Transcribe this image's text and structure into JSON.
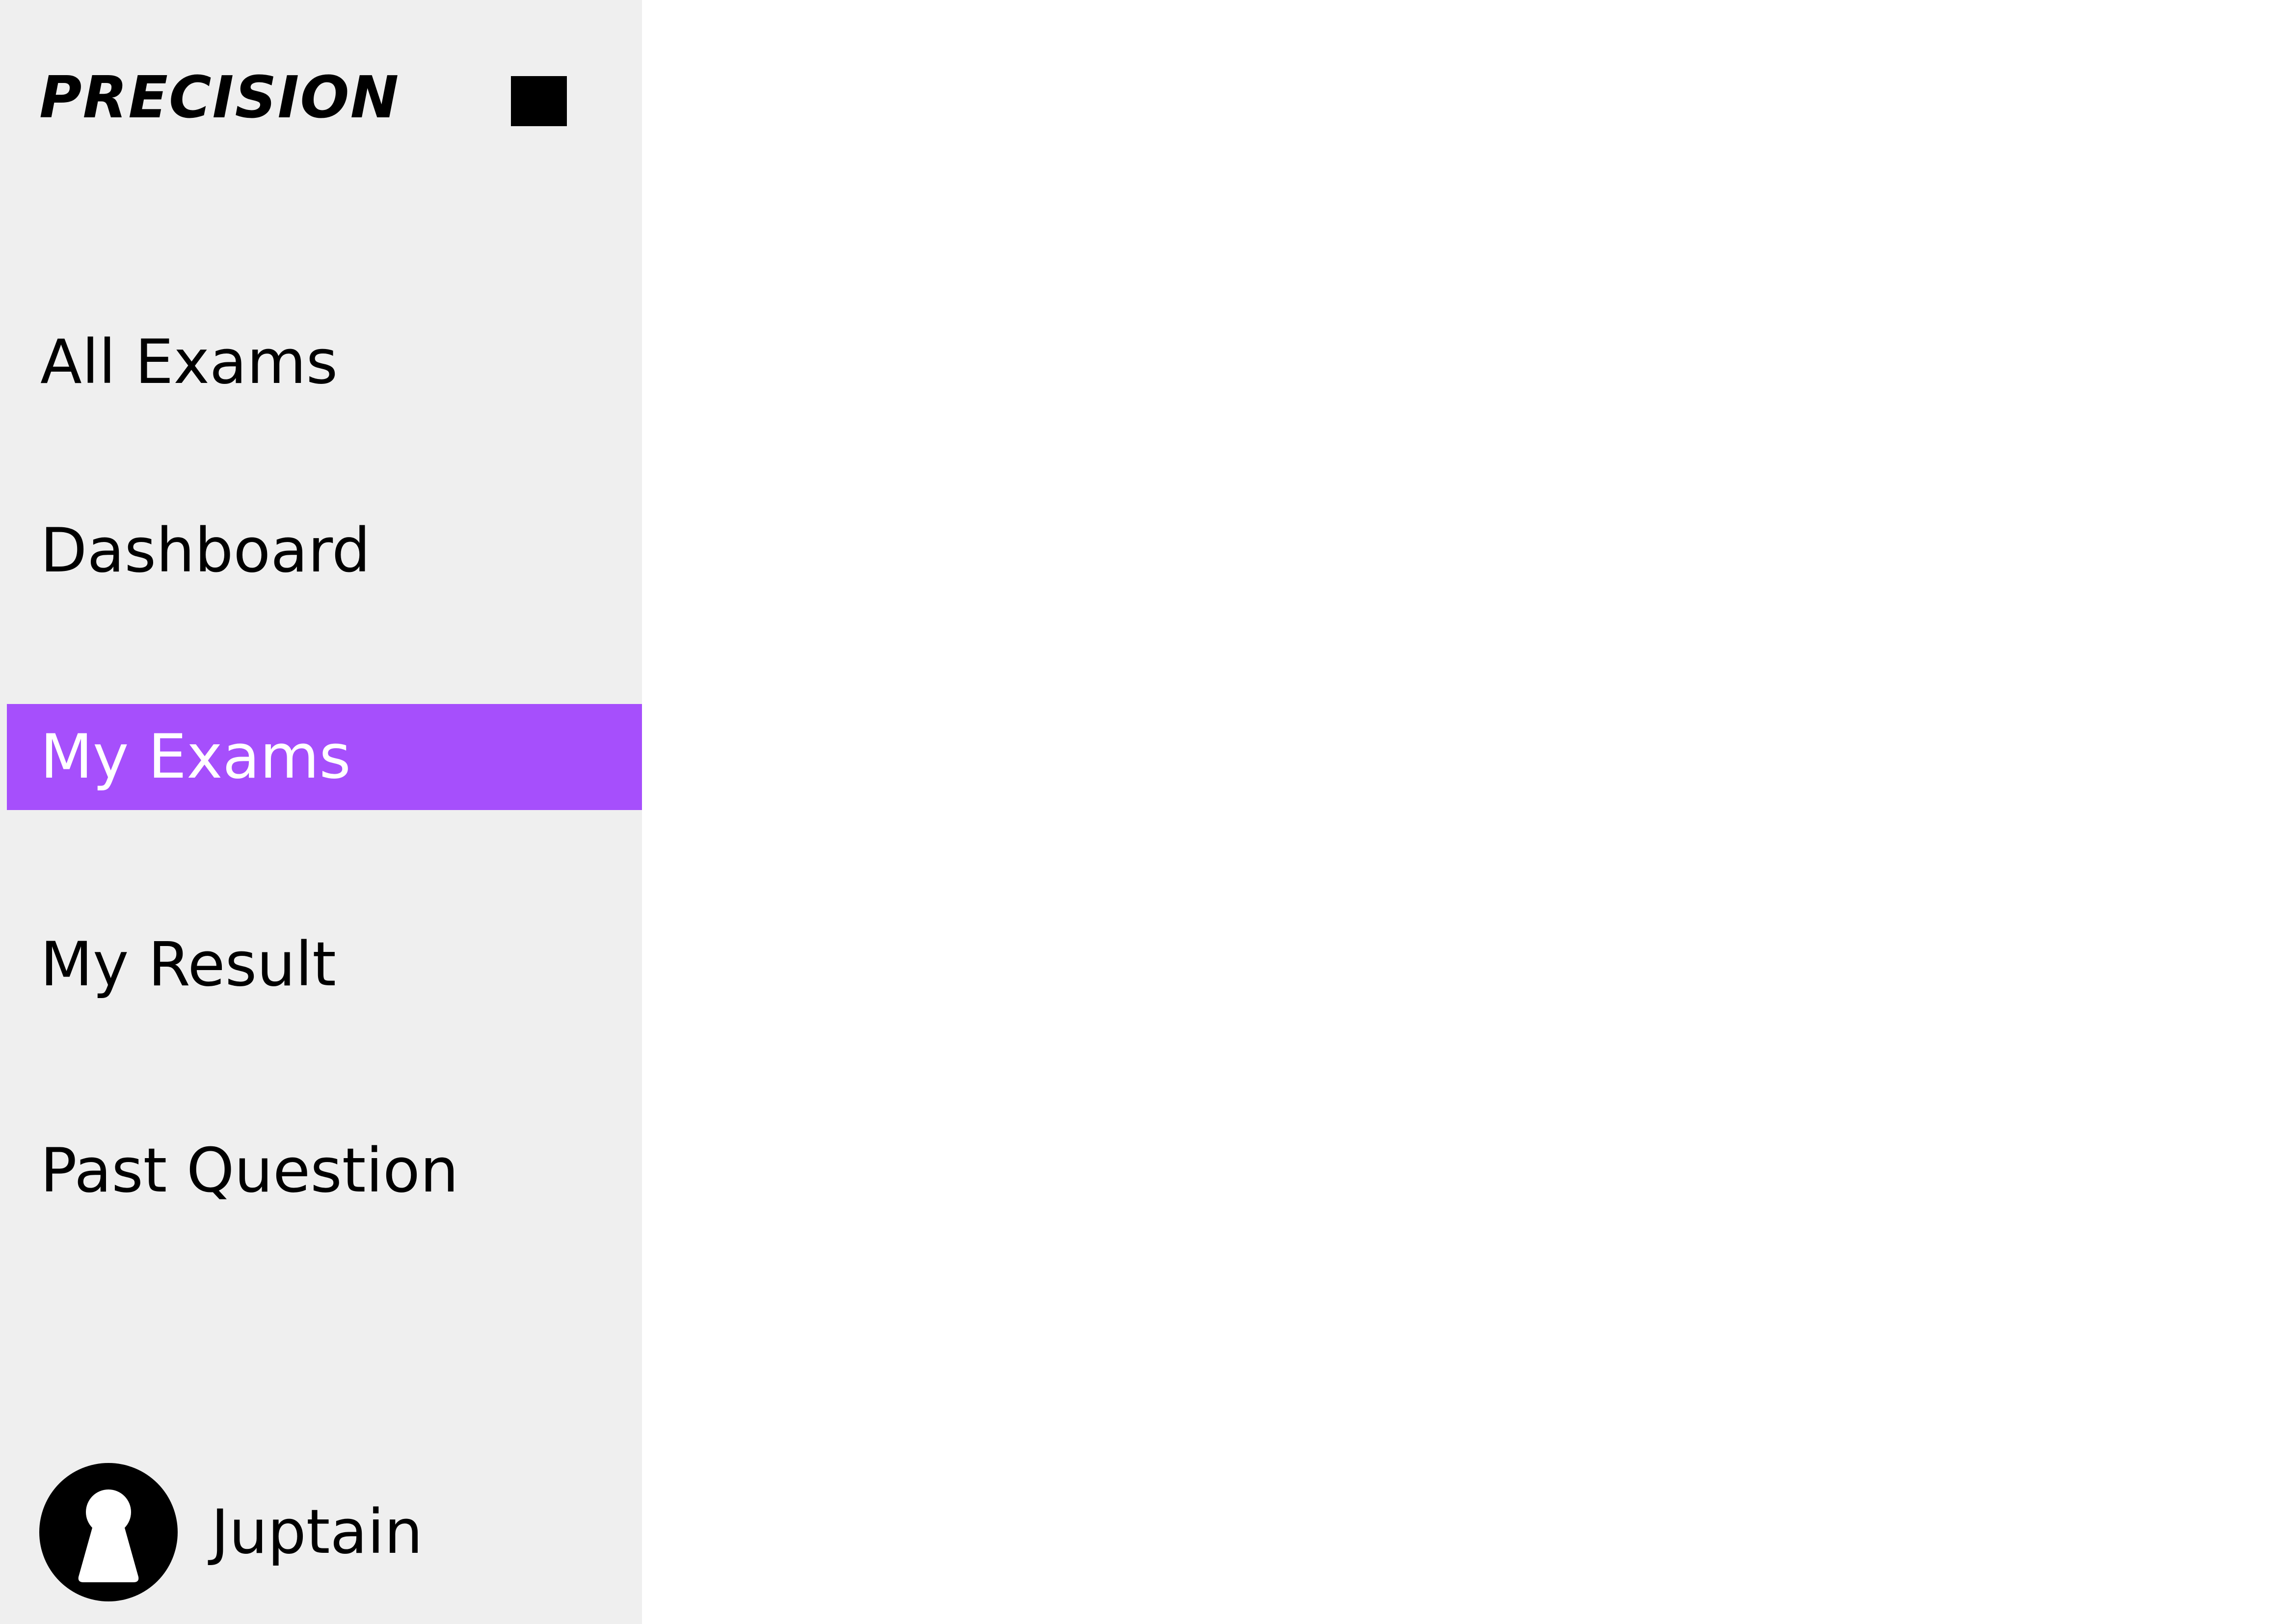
{
  "brand": {
    "logo_text": "PRECISION"
  },
  "sidebar": {
    "menu_toggle_icon": "square-menu-icon",
    "items": [
      {
        "label": "All Exams",
        "active": false
      },
      {
        "label": "Dashboard",
        "active": false
      },
      {
        "label": "My Exams",
        "active": true
      },
      {
        "label": "My Result",
        "active": false
      },
      {
        "label": "Past Question",
        "active": false
      }
    ]
  },
  "user": {
    "name": "Juptain",
    "avatar_icon": "user-avatar-icon"
  },
  "colors": {
    "sidebar_background": "#efefef",
    "active_item_background": "#a64ffc",
    "active_item_text": "#ffffff",
    "text": "#000000",
    "main_background": "#ffffff"
  }
}
